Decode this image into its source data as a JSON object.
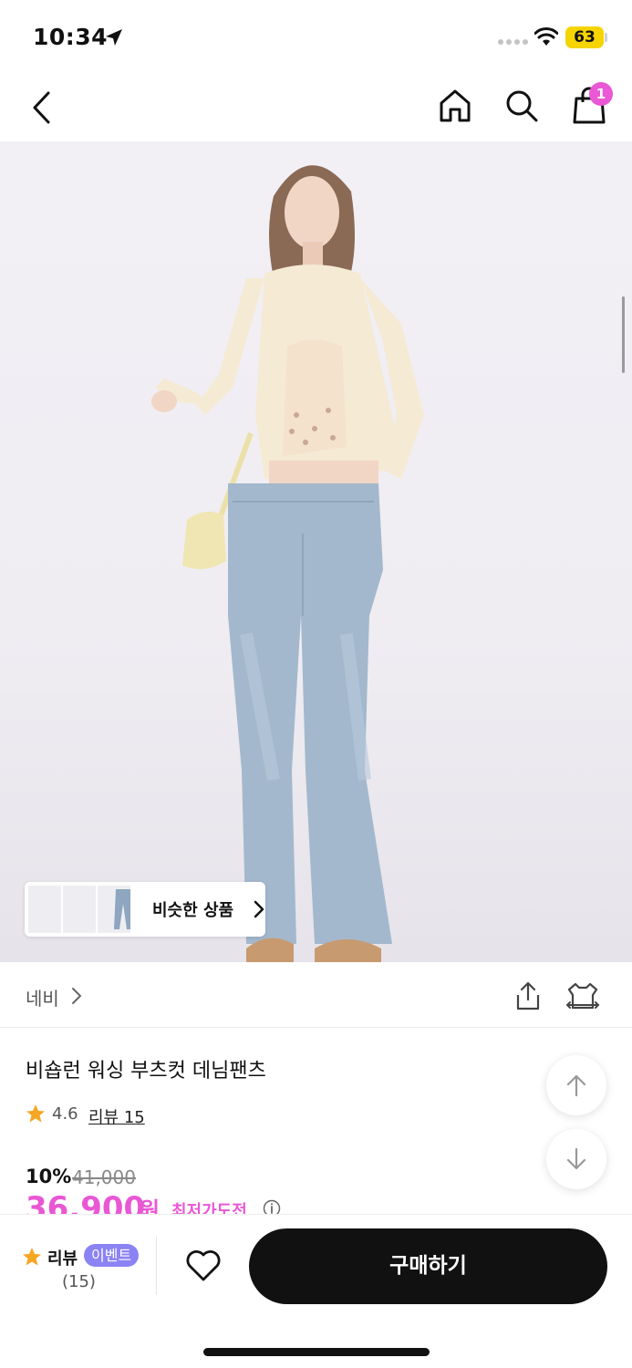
{
  "status_bar": {
    "time": "10:34",
    "battery": "63"
  },
  "nav": {
    "cart_count": "1"
  },
  "hero": {
    "similar_label": "비슷한 상품"
  },
  "brand": {
    "name": "네비"
  },
  "product": {
    "title": "비숍런 워싱 부츠컷 데님팬츠",
    "rating": "4.6",
    "review_link": "리뷰 15",
    "discount": "10%",
    "original_price": "41,000",
    "price": "36,900",
    "price_unit": "원",
    "lowest_price_label": "최저가도전"
  },
  "bottom_bar": {
    "review_label": "리뷰",
    "event_badge": "이벤트",
    "review_count": "(15)",
    "buy_label": "구매하기"
  },
  "colors": {
    "accent_pink": "#e957d4",
    "event_purple": "#8b82f3",
    "cta_black": "#111111"
  }
}
